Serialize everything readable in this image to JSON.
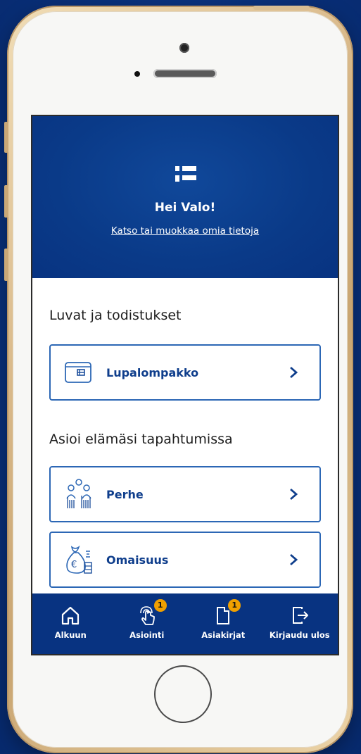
{
  "header": {
    "greeting": "Hei Valo!",
    "profile_link": "Katso tai muokkaa omia tietoja"
  },
  "sections": [
    {
      "title": "Luvat ja todistukset",
      "cards": [
        {
          "label": "Lupalompakko",
          "icon": "wallet-icon"
        }
      ]
    },
    {
      "title": "Asioi elämäsi tapahtumissa",
      "cards": [
        {
          "label": "Perhe",
          "icon": "family-icon"
        },
        {
          "label": "Omaisuus",
          "icon": "money-bag-icon"
        }
      ]
    }
  ],
  "tabbar": {
    "items": [
      {
        "label": "Alkuun",
        "icon": "home-icon"
      },
      {
        "label": "Asiointi",
        "icon": "touch-icon",
        "badge": "1"
      },
      {
        "label": "Asiakirjat",
        "icon": "document-icon",
        "badge": "1"
      },
      {
        "label": "Kirjaudu ulos",
        "icon": "logout-icon"
      }
    ]
  },
  "colors": {
    "primary": "#083381",
    "accent": "#2c67b5",
    "badge": "#f0a000",
    "background": "#0a3380"
  }
}
